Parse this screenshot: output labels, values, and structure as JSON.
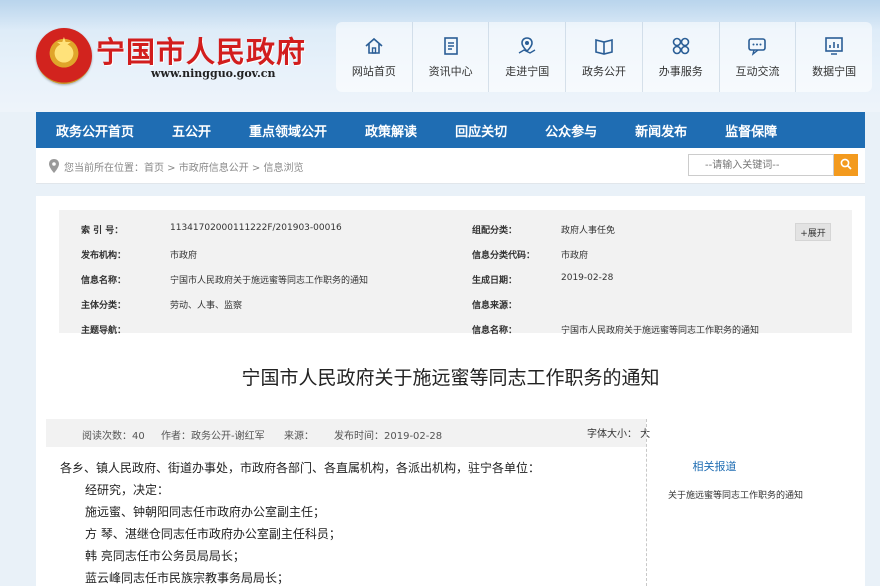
{
  "site": {
    "title": "宁国市人民政府",
    "url": "www.ningguo.gov.cn"
  },
  "quick_nav": [
    {
      "label": "网站首页",
      "icon": "home-icon"
    },
    {
      "label": "资讯中心",
      "icon": "document-icon"
    },
    {
      "label": "走进宁国",
      "icon": "map-pin-icon"
    },
    {
      "label": "政务公开",
      "icon": "open-book-icon"
    },
    {
      "label": "办事服务",
      "icon": "grid-icon"
    },
    {
      "label": "互动交流",
      "icon": "chat-icon"
    },
    {
      "label": "数据宁国",
      "icon": "bar-chart-icon"
    }
  ],
  "main_nav": [
    "政务公开首页",
    "五公开",
    "重点领域公开",
    "政策解读",
    "回应关切",
    "公众参与",
    "新闻发布",
    "监督保障"
  ],
  "breadcrumb": "您当前所在位置：首页 > 市政府信息公开 > 信息浏览",
  "search": {
    "placeholder": "--请输入关键词--"
  },
  "meta": {
    "expand_label": "+展开",
    "left": [
      {
        "label": "索 引 号：",
        "value": "11341702000111222F/201903-00016"
      },
      {
        "label": "发布机构：",
        "value": "市政府"
      },
      {
        "label": "信息名称：",
        "value": "宁国市人民政府关于施远蜜等同志工作职务的通知"
      },
      {
        "label": "主体分类：",
        "value": "劳动、人事、监察"
      },
      {
        "label": "主题导航：",
        "value": ""
      }
    ],
    "right": [
      {
        "label": "组配分类：",
        "value": "政府人事任免"
      },
      {
        "label": "信息分类代码：",
        "value": "市政府"
      },
      {
        "label": "生成日期：",
        "value": "2019-02-28"
      },
      {
        "label": "信息来源：",
        "value": ""
      },
      {
        "label": "信息名称：",
        "value": "宁国市人民政府关于施远蜜等同志工作职务的通知"
      }
    ]
  },
  "doc_title": "宁国市人民政府关于施远蜜等同志工作职务的通知",
  "info": {
    "reads": "阅读次数：40",
    "author": "作者：政务公开-谢红军",
    "source": "来源：",
    "pubtime": "发布时间：2019-02-28",
    "font_size": "字体大小： 大"
  },
  "related": {
    "title": "相关报道",
    "items": [
      "关于施远蜜等同志工作职务的通知"
    ]
  },
  "body_lines": [
    "各乡、镇人民政府、街道办事处，市政府各部门、各直属机构，各派出机构，驻宁各单位：",
    "经研究，决定：",
    "施远蜜、钟朝阳同志任市政府办公室副主任；",
    "方  琴、湛继仓同志任市政府办公室副主任科员；",
    "韩  亮同志任市公务员局局长；",
    "蓝云峰同志任市民族宗教事务局局长；"
  ],
  "colors": {
    "nav_blue": "#1f6db3",
    "title_red": "#d21d1d",
    "search_orange": "#f39a1e"
  }
}
